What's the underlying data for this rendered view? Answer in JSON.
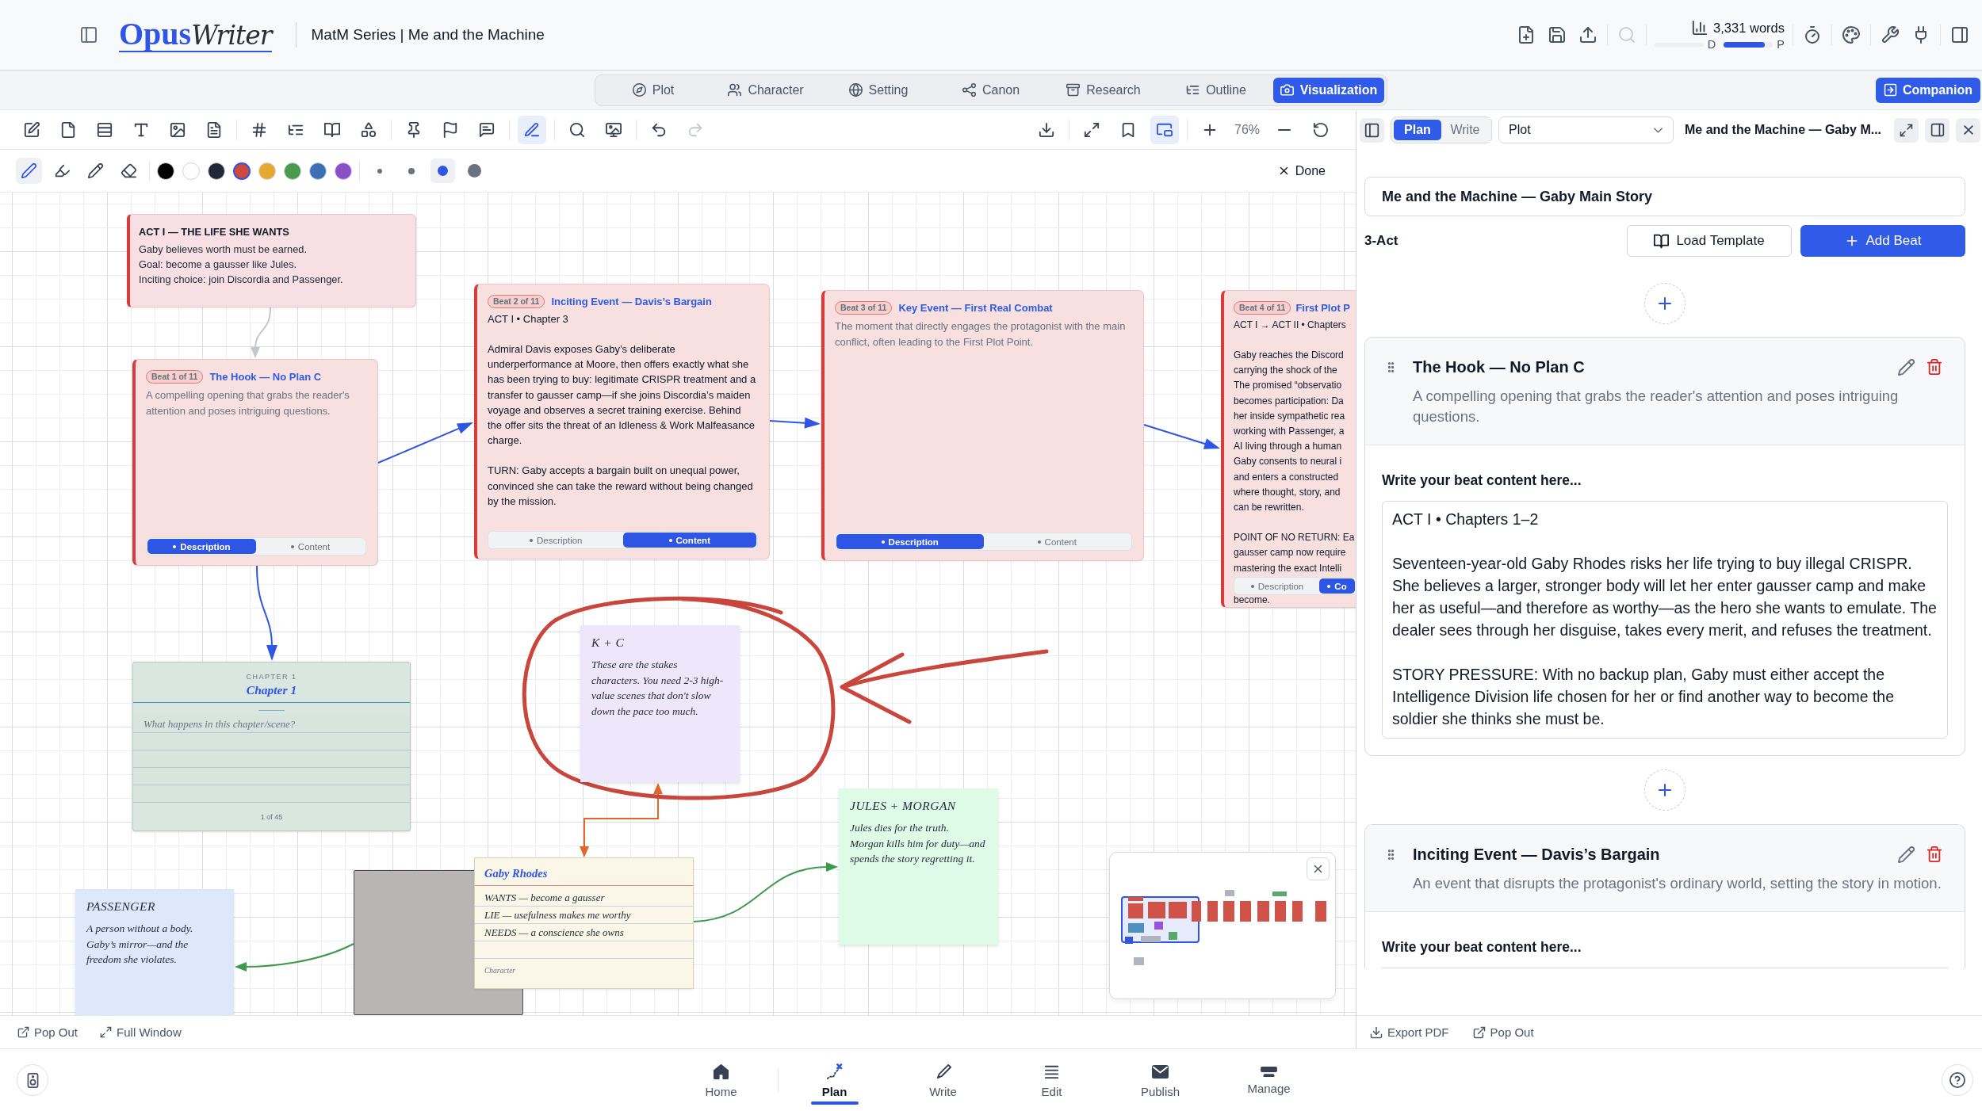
{
  "header": {
    "logo": {
      "primary": "Opus",
      "secondary": "Writer"
    },
    "title": "MatM Series | Me and the Machine",
    "tools": [
      {
        "disabled": false
      },
      {
        "disabled": false
      },
      {
        "disabled": false
      },
      {
        "disabled": true
      },
      {
        "disabled": false
      },
      {
        "disabled": false
      },
      {
        "disabled": false
      },
      {
        "disabled": false
      },
      {
        "disabled": false
      }
    ],
    "word_count": {
      "label": "3,331 words",
      "stage": {
        "start": "D",
        "end": "P",
        "level": 0.84
      }
    }
  },
  "tabs": [
    {
      "label": "Plot",
      "selected": false
    },
    {
      "label": "Character",
      "selected": false
    },
    {
      "label": "Setting",
      "selected": false
    },
    {
      "label": "Canon",
      "selected": false
    },
    {
      "label": "Research",
      "selected": false
    },
    {
      "label": "Outline",
      "selected": false
    },
    {
      "label": "Visualization",
      "selected": true
    }
  ],
  "companion_button": "Companion",
  "canvas_toolbar": {
    "left_tools": [
      {
        "selected": false,
        "disabled": false
      },
      {
        "selected": false,
        "disabled": false
      },
      {
        "selected": false,
        "disabled": false
      },
      {
        "selected": false,
        "disabled": false
      },
      {
        "selected": false,
        "disabled": false
      },
      {
        "selected": false,
        "disabled": false
      },
      {
        "selected": false,
        "disabled": false
      },
      {
        "selected": false,
        "disabled": false
      },
      {
        "selected": false,
        "disabled": false
      },
      {
        "selected": false,
        "disabled": false
      },
      {
        "selected": false,
        "disabled": false
      },
      {
        "selected": false,
        "disabled": false
      },
      {
        "selected": false,
        "disabled": false
      },
      {
        "selected": true,
        "disabled": false
      },
      {
        "selected": false,
        "disabled": false
      },
      {
        "selected": false,
        "disabled": false
      },
      {
        "selected": false,
        "disabled": false
      },
      {
        "selected": false,
        "disabled": true
      }
    ],
    "right_tools": [
      {
        "selected": false,
        "disabled": false
      },
      {
        "selected": false,
        "disabled": false
      },
      {
        "selected": false,
        "disabled": false
      },
      {
        "selected": true,
        "disabled": false
      },
      {
        "selected": false,
        "disabled": false
      },
      {
        "selected": false,
        "disabled": false
      },
      {
        "selected": false,
        "disabled": false
      }
    ],
    "zoom": "76%"
  },
  "draw_toolbar": {
    "tools": [
      {
        "selected": true
      },
      {
        "selected": false
      },
      {
        "selected": false
      },
      {
        "selected": false
      }
    ],
    "colors": [
      {
        "color": "#000000",
        "selected": false
      },
      {
        "color": "#ffffff",
        "selected": false
      },
      {
        "color": "#1f2937",
        "selected": false
      },
      {
        "color": "#d04a3c",
        "selected": true
      },
      {
        "color": "#e6a92f",
        "selected": false
      },
      {
        "color": "#4a9a4e",
        "selected": false
      },
      {
        "color": "#3d6fb4",
        "selected": false
      },
      {
        "color": "#8b50c8",
        "selected": false
      }
    ],
    "sizes": [
      {
        "selected": false
      },
      {
        "selected": false
      },
      {
        "selected": true
      },
      {
        "selected": false
      }
    ],
    "done": "Done"
  },
  "canvas": {
    "nodes": [
      {
        "kind": "act_note",
        "title": "ACT I — THE LIFE SHE WANTS",
        "lines": [
          "Gaby believes worth must be earned.",
          "Goal: become a gausser like Jules.",
          "Inciting choice: join Discordia and Passenger."
        ]
      },
      {
        "kind": "beat",
        "cut_off": false,
        "badge": "Beat 1 of 11",
        "title": "The Hook — No Plan C",
        "description": "A compelling opening that grabs the reader's attention and poses intriguing questions.",
        "toggle": [
          {
            "label": "Description",
            "selected": true
          },
          {
            "label": "Content",
            "selected": false
          }
        ]
      },
      {
        "kind": "beat",
        "cut_off": false,
        "badge": "Beat 2 of 11",
        "title": "Inciting Event — Davis’s Bargain",
        "content": {
          "heading": "ACT I • Chapter 3",
          "paragraphs": [
            "Admiral Davis exposes Gaby’s deliberate underperformance at Moore, then offers exactly what she has been trying to buy: legitimate CRISPR treatment and a transfer to gausser camp—if she joins Discordia’s maiden voyage and observes a secret training exercise. Behind the offer sits the threat of an Idleness & Work Malfeasance charge.",
            "TURN: Gaby accepts a bargain built on unequal power, convinced she can take the reward without being changed by the mission."
          ]
        },
        "toggle": [
          {
            "label": "Description",
            "selected": false
          },
          {
            "label": "Content",
            "selected": true
          }
        ]
      },
      {
        "kind": "beat",
        "cut_off": false,
        "badge": "Beat 3 of 11",
        "title": "Key Event — First Real Combat",
        "description": "The moment that directly engages the protagonist with the main conflict, often leading to the First Plot Point.",
        "toggle": [
          {
            "label": "Description",
            "selected": true
          },
          {
            "label": "Content",
            "selected": false
          }
        ]
      },
      {
        "kind": "beat",
        "cut_off": true,
        "badge": "Beat 4 of 11",
        "title": "First Plot P",
        "content": {
          "heading": "ACT I → ACT II • Chapters",
          "paragraphs": [
            "Gaby reaches the Discord\ncarrying the shock of the\nThe promised “observatio\nbecomes participation: Da\nher inside sympathetic rea\nworking with Passenger, a\nAI living through a human\nGaby consents to neural i\nand enters a constructed\nwhere thought, story, and\ncan be rewritten.",
            "POINT OF NO RETURN: Ea\ngausser camp now require\nmastering the exact Intelli"
          ]
        },
        "toggle": [
          {
            "label": "Description",
            "selected": false
          },
          {
            "label": "Co",
            "selected": true
          }
        ],
        "trailing_text": "become."
      },
      {
        "kind": "chapter",
        "eyebrow": "CHAPTER 1",
        "title": "Chapter 1",
        "placeholder": "What happens in this chapter/scene?",
        "page": "1 of 45"
      },
      {
        "kind": "sticky",
        "color": "#eee7fb",
        "title": "K + C",
        "text": "These are the stakes characters. You need 2-3 high-value scenes that don't slow down the pace too much."
      },
      {
        "kind": "sticky",
        "color": "#ddfbe6",
        "title": "JULES + MORGAN",
        "text": "Jules dies for the truth.\nMorgan kills him for duty—and spends the story regretting it."
      },
      {
        "kind": "photo"
      },
      {
        "kind": "character",
        "name": "Gaby Rhodes",
        "traits": [
          "WANTS — become a gausser",
          "LIE — usefulness makes me worthy",
          "NEEDS — a conscience she owns"
        ],
        "type": "Character"
      },
      {
        "kind": "sticky",
        "color": "#dde8fb",
        "title": "PASSENGER",
        "text": "A person without a body.\nGaby’s mirror—and the freedom she violates."
      }
    ]
  },
  "minimap": {
    "open": true
  },
  "canvas_footer": [
    "Pop Out",
    "Full Window"
  ],
  "companion": {
    "mode_tabs": [
      {
        "label": "Plan",
        "selected": true
      },
      {
        "label": "Write",
        "selected": false
      }
    ],
    "view": "Plot",
    "heading": "Me and the Machine — Gaby M...",
    "story_title": "Me and the Machine — Gaby Main Story",
    "structure": "3-Act",
    "load_button": "Load Template",
    "add_button": "Add Beat",
    "beats": [
      {
        "title": "The Hook — No Plan C",
        "description": "A compelling opening that grabs the reader's attention and poses intriguing questions.",
        "content_label": "Write your beat content here...",
        "content": "ACT I • Chapters 1–2\n\nSeventeen-year-old Gaby Rhodes risks her life trying to buy illegal CRISPR. She believes a larger, stronger body will let her enter gausser camp and make her as useful—and therefore as worthy—as the hero she wants to emulate. The dealer sees through her disguise, takes every merit, and refuses the treatment.\n\nSTORY PRESSURE: With no backup plan, Gaby must either accept the Intelligence Division life chosen for her or find another way to become the soldier she thinks she must be."
      },
      {
        "title": "Inciting Event — Davis’s Bargain",
        "description": "An event that disrupts the protagonist's ordinary world, setting the story in motion.",
        "content_label": "Write your beat content here..."
      }
    ],
    "footer": [
      "Export PDF",
      "Pop Out"
    ]
  },
  "bottom_nav": [
    {
      "label": "Home",
      "selected": false
    },
    {
      "label": "Plan",
      "selected": true
    },
    {
      "label": "Write",
      "selected": false
    },
    {
      "label": "Edit",
      "selected": false
    },
    {
      "label": "Publish",
      "selected": false
    },
    {
      "label": "Manage",
      "selected": false
    }
  ]
}
